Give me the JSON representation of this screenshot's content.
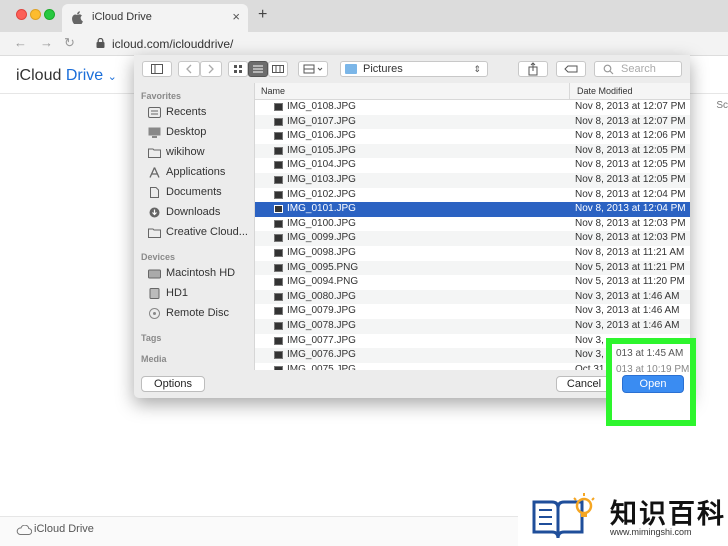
{
  "browser": {
    "tab_title": "iCloud Drive",
    "tab_close": "×",
    "new_tab": "+",
    "back": "←",
    "forward": "→",
    "reload": "↻",
    "url": "icloud.com/iclouddrive/"
  },
  "page": {
    "brand_prefix": "iCloud",
    "brand_suffix": "Drive",
    "brand_chevron": "⌄",
    "right_cut": "Sc",
    "footer_text": "iCloud Drive"
  },
  "dialog": {
    "path_label": "Pictures",
    "search_placeholder": "Search",
    "col_name": "Name",
    "col_date": "Date Modified",
    "sidebar": {
      "favorites_heading": "Favorites",
      "favorites": [
        {
          "label": "Recents",
          "icon": "recents-icon"
        },
        {
          "label": "Desktop",
          "icon": "desktop-icon"
        },
        {
          "label": "wikihow",
          "icon": "folder-icon"
        },
        {
          "label": "Applications",
          "icon": "applications-icon"
        },
        {
          "label": "Documents",
          "icon": "documents-icon"
        },
        {
          "label": "Downloads",
          "icon": "downloads-icon"
        },
        {
          "label": "Creative Cloud...",
          "icon": "folder-icon"
        }
      ],
      "devices_heading": "Devices",
      "devices": [
        {
          "label": "Macintosh HD",
          "icon": "harddrive-icon"
        },
        {
          "label": "HD1",
          "icon": "harddrive-icon"
        },
        {
          "label": "Remote Disc",
          "icon": "disc-icon"
        }
      ],
      "tags_heading": "Tags",
      "media_heading": "Media"
    },
    "files": [
      {
        "name": "IMG_0108.JPG",
        "date": "Nov 8, 2013 at 12:07 PM"
      },
      {
        "name": "IMG_0107.JPG",
        "date": "Nov 8, 2013 at 12:07 PM"
      },
      {
        "name": "IMG_0106.JPG",
        "date": "Nov 8, 2013 at 12:06 PM"
      },
      {
        "name": "IMG_0105.JPG",
        "date": "Nov 8, 2013 at 12:05 PM"
      },
      {
        "name": "IMG_0104.JPG",
        "date": "Nov 8, 2013 at 12:05 PM"
      },
      {
        "name": "IMG_0103.JPG",
        "date": "Nov 8, 2013 at 12:05 PM"
      },
      {
        "name": "IMG_0102.JPG",
        "date": "Nov 8, 2013 at 12:04 PM"
      },
      {
        "name": "IMG_0101.JPG",
        "date": "Nov 8, 2013 at 12:04 PM"
      },
      {
        "name": "IMG_0100.JPG",
        "date": "Nov 8, 2013 at 12:03 PM"
      },
      {
        "name": "IMG_0099.JPG",
        "date": "Nov 8, 2013 at 12:03 PM"
      },
      {
        "name": "IMG_0098.JPG",
        "date": "Nov 8, 2013 at 11:21 AM"
      },
      {
        "name": "IMG_0095.PNG",
        "date": "Nov 5, 2013 at 11:21 PM"
      },
      {
        "name": "IMG_0094.PNG",
        "date": "Nov 5, 2013 at 11:20 PM"
      },
      {
        "name": "IMG_0080.JPG",
        "date": "Nov 3, 2013 at 1:46 AM"
      },
      {
        "name": "IMG_0079.JPG",
        "date": "Nov 3, 2013 at 1:46 AM"
      },
      {
        "name": "IMG_0078.JPG",
        "date": "Nov 3, 2013 at 1:46 AM"
      },
      {
        "name": "IMG_0077.JPG",
        "date": "Nov 3,"
      },
      {
        "name": "IMG_0076.JPG",
        "date": "Nov 3,"
      },
      {
        "name": "IMG_0075.JPG",
        "date": "Oct 31,"
      }
    ],
    "selected_index": 7,
    "options_label": "Options",
    "cancel_label": "Cancel",
    "open_label": "Open",
    "highlight_date": "013 at 1:45 AM",
    "highlight_date2": "013 at 10:19 PM"
  },
  "watermark": {
    "text": "知识百科",
    "url": "www.mimingshi.com"
  },
  "colors": {
    "accent": "#3a8cf2",
    "selection": "#2b62c2",
    "highlight": "#2df52d"
  }
}
